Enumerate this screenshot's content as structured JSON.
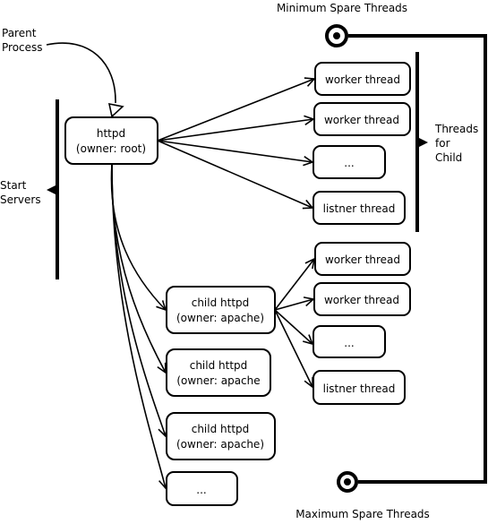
{
  "labels": {
    "min_spare": "Minimum Spare Threads",
    "max_spare": "Maximum Spare Threads",
    "parent_process": [
      "Parent",
      "Process"
    ],
    "start_servers": [
      "Start",
      "Servers"
    ],
    "threads_for_child": [
      "Threads",
      "for",
      "Child"
    ]
  },
  "parent": {
    "line1": "httpd",
    "line2": "(owner: root)"
  },
  "parent_threads": [
    "worker thread",
    "worker thread",
    "...",
    "listner thread"
  ],
  "children": [
    {
      "line1": "child httpd",
      "line2": "(owner: apache)"
    },
    {
      "line1": "child httpd",
      "line2": "(owner: apache"
    },
    {
      "line1": "child httpd",
      "line2": "(owner: apache)"
    },
    {
      "line1": "...",
      "line2": ""
    }
  ],
  "child_threads": [
    "worker thread",
    "worker thread",
    "...",
    "listner thread"
  ]
}
